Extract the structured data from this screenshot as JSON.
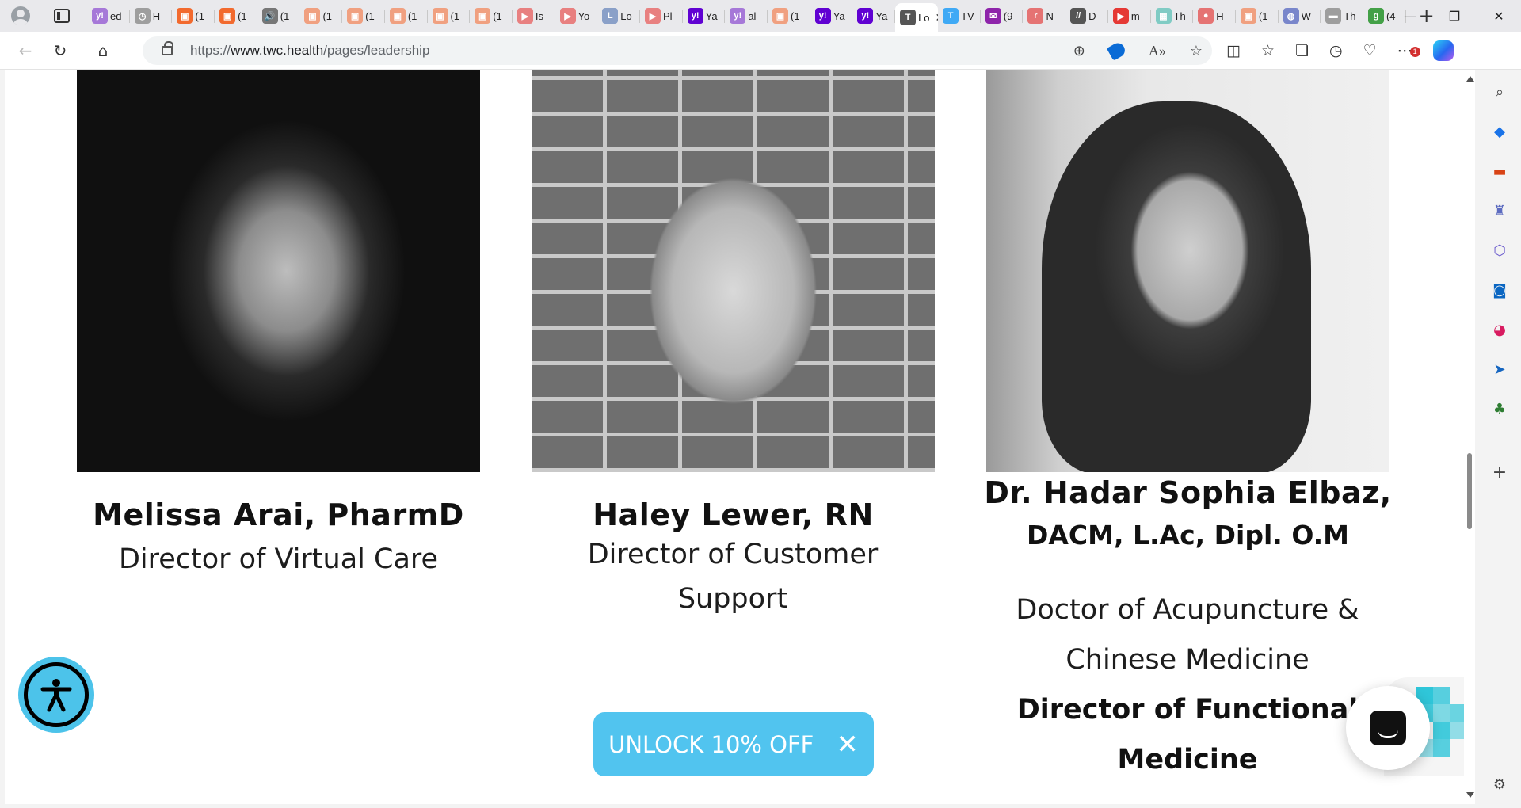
{
  "browser": {
    "tabs": [
      {
        "title": "ed",
        "color": "#a678d8",
        "glyph": "y!"
      },
      {
        "title": "H",
        "color": "#9e9e9e",
        "glyph": "◷"
      },
      {
        "title": "(1",
        "color": "#f26a2e",
        "glyph": "▣"
      },
      {
        "title": "(1",
        "color": "#f26a2e",
        "glyph": "▣"
      },
      {
        "title": "(1",
        "color": "#777777",
        "glyph": "🔊"
      },
      {
        "title": "(1",
        "color": "#f0a080",
        "glyph": "▣"
      },
      {
        "title": "(1",
        "color": "#f0a080",
        "glyph": "▣"
      },
      {
        "title": "(1",
        "color": "#f0a080",
        "glyph": "▣"
      },
      {
        "title": "(1",
        "color": "#f0a080",
        "glyph": "▣"
      },
      {
        "title": "(1",
        "color": "#f0a080",
        "glyph": "▣"
      },
      {
        "title": "Is",
        "color": "#e88080",
        "glyph": "▶"
      },
      {
        "title": "Yo",
        "color": "#e88080",
        "glyph": "▶"
      },
      {
        "title": "Lo",
        "color": "#8aa0c8",
        "glyph": "L"
      },
      {
        "title": "Pl",
        "color": "#e88080",
        "glyph": "▶"
      },
      {
        "title": "Ya",
        "color": "#6001d2",
        "glyph": "y!"
      },
      {
        "title": "al",
        "color": "#a678d8",
        "glyph": "y!"
      },
      {
        "title": "(1",
        "color": "#f0a080",
        "glyph": "▣"
      },
      {
        "title": "Ya",
        "color": "#6001d2",
        "glyph": "y!"
      },
      {
        "title": "Ya",
        "color": "#6001d2",
        "glyph": "y!"
      },
      {
        "title": "TV",
        "color": "#3fa9f5",
        "glyph": "T"
      },
      {
        "title": "(9",
        "color": "#8e24aa",
        "glyph": "✉"
      },
      {
        "title": "N",
        "color": "#e57373",
        "glyph": "r"
      },
      {
        "title": "D",
        "color": "#555555",
        "glyph": "//"
      },
      {
        "title": "m",
        "color": "#e53935",
        "glyph": "▶"
      },
      {
        "title": "Th",
        "color": "#80cbc4",
        "glyph": "▦"
      },
      {
        "title": "H",
        "color": "#e57373",
        "glyph": "●"
      },
      {
        "title": "(1",
        "color": "#f0a080",
        "glyph": "▣"
      },
      {
        "title": "W",
        "color": "#7986cb",
        "glyph": "◍"
      },
      {
        "title": "Th",
        "color": "#9e9e9e",
        "glyph": "▬"
      },
      {
        "title": "(4",
        "color": "#43a047",
        "glyph": "g"
      }
    ],
    "active_tab": {
      "title": "Lo",
      "color": "#555555",
      "glyph": "T"
    },
    "url_prefix": "https://",
    "url_domain": "www.twc.health",
    "url_path": "/pages/leadership"
  },
  "leadership": [
    {
      "name": "Melissa Arai, PharmD",
      "role": "Director of Virtual Care"
    },
    {
      "name": "Haley Lewer, RN",
      "role": "Director of Customer Support"
    },
    {
      "name": "Dr. Hadar Sophia Elbaz,",
      "credentials": "DACM, L.Ac, Dipl. O.M",
      "role": "Doctor of Acupuncture & Chinese Medicine",
      "role_bold": "Director of Functional Medicine"
    }
  ],
  "promo": {
    "label": "UNLOCK 10% OFF",
    "close": "✕"
  },
  "colors": {
    "accent": "#51c4ef",
    "a11y": "#4cc3ea",
    "text": "#111111"
  }
}
